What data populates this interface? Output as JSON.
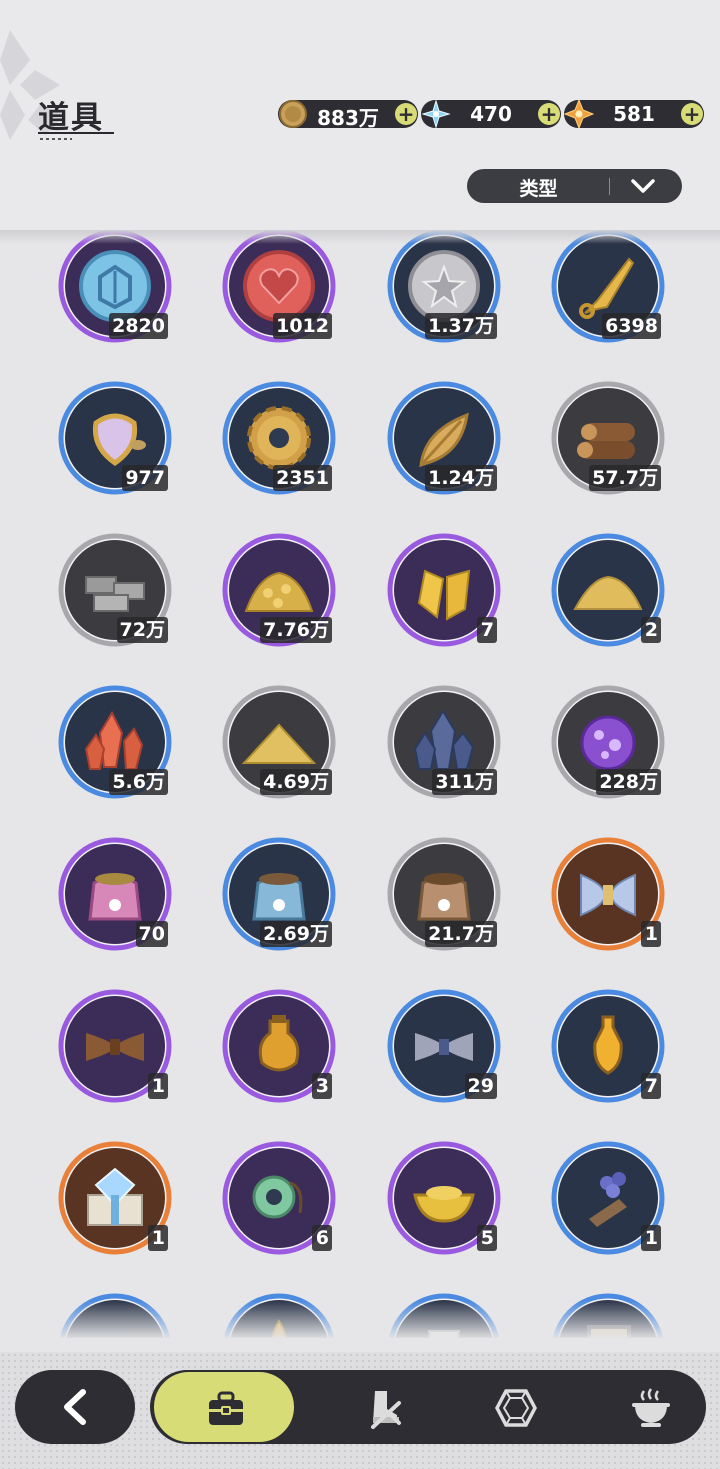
{
  "header": {
    "title": "道具"
  },
  "currencies": [
    {
      "icon": "gold-coin-icon",
      "value": "883万"
    },
    {
      "icon": "crystal-flower-icon",
      "value": "470"
    },
    {
      "icon": "orange-star-icon",
      "value": "581"
    }
  ],
  "filter": {
    "label": "类型"
  },
  "items": [
    {
      "icon": "blue-emblem-coin-icon",
      "rarity": "epic",
      "count": "2820"
    },
    {
      "icon": "red-heart-coin-icon",
      "rarity": "epic",
      "count": "1012"
    },
    {
      "icon": "silver-star-coin-icon",
      "rarity": "rare",
      "count": "1.37万"
    },
    {
      "icon": "golden-blade-icon",
      "rarity": "rare",
      "count": "6398"
    },
    {
      "icon": "scale-mirror-icon",
      "rarity": "rare",
      "count": "977"
    },
    {
      "icon": "golden-gear-icon",
      "rarity": "rare",
      "count": "2351"
    },
    {
      "icon": "golden-leaf-icon",
      "rarity": "rare",
      "count": "1.24万"
    },
    {
      "icon": "wood-logs-icon",
      "rarity": "common",
      "count": "57.7万"
    },
    {
      "icon": "stone-bricks-icon",
      "rarity": "common",
      "count": "72万"
    },
    {
      "icon": "gold-ore-pile-icon",
      "rarity": "epic",
      "count": "7.76万"
    },
    {
      "icon": "gold-crystal-shards-icon",
      "rarity": "epic",
      "count": "7"
    },
    {
      "icon": "gold-sand-pile-icon",
      "rarity": "rare",
      "count": "2"
    },
    {
      "icon": "red-crystal-icon",
      "rarity": "rare",
      "count": "5.6万"
    },
    {
      "icon": "sand-pile-icon",
      "rarity": "common",
      "count": "4.69万"
    },
    {
      "icon": "dark-crystal-icon",
      "rarity": "common",
      "count": "311万"
    },
    {
      "icon": "purple-orb-icon",
      "rarity": "common",
      "count": "228万"
    },
    {
      "icon": "pink-paw-bag-icon",
      "rarity": "epic",
      "count": "70"
    },
    {
      "icon": "blue-paw-bag-icon",
      "rarity": "rare",
      "count": "2.69万"
    },
    {
      "icon": "brown-paw-bag-icon",
      "rarity": "common",
      "count": "21.7万"
    },
    {
      "icon": "cloth-bundle-icon",
      "rarity": "legendary",
      "count": "1"
    },
    {
      "icon": "brown-fiber-bundle-icon",
      "rarity": "epic",
      "count": "1"
    },
    {
      "icon": "amber-potion-icon",
      "rarity": "epic",
      "count": "3"
    },
    {
      "icon": "silver-fiber-bundle-icon",
      "rarity": "rare",
      "count": "29"
    },
    {
      "icon": "amber-vial-icon",
      "rarity": "rare",
      "count": "7"
    },
    {
      "icon": "diamond-giftbox-icon",
      "rarity": "legendary",
      "count": "1"
    },
    {
      "icon": "jade-pendant-icon",
      "rarity": "epic",
      "count": "6"
    },
    {
      "icon": "gold-ingot-icon",
      "rarity": "epic",
      "count": "5"
    },
    {
      "icon": "flower-bouquet-icon",
      "rarity": "rare",
      "count": "1"
    },
    {
      "icon": "white-cloth-icon",
      "rarity": "rare",
      "count": ""
    },
    {
      "icon": "golden-feather-icon",
      "rarity": "rare",
      "count": ""
    },
    {
      "icon": "white-cup-icon",
      "rarity": "rare",
      "count": ""
    },
    {
      "icon": "picture-frame-icon",
      "rarity": "rare",
      "count": ""
    }
  ],
  "nav": [
    {
      "name": "back",
      "icon": "chevron-left-icon"
    },
    {
      "name": "tab-items",
      "icon": "briefcase-icon",
      "active": true
    },
    {
      "name": "tab-equipment",
      "icon": "boot-sword-icon"
    },
    {
      "name": "tab-gems",
      "icon": "gem-outline-icon"
    },
    {
      "name": "tab-food",
      "icon": "cooking-pot-icon"
    }
  ]
}
